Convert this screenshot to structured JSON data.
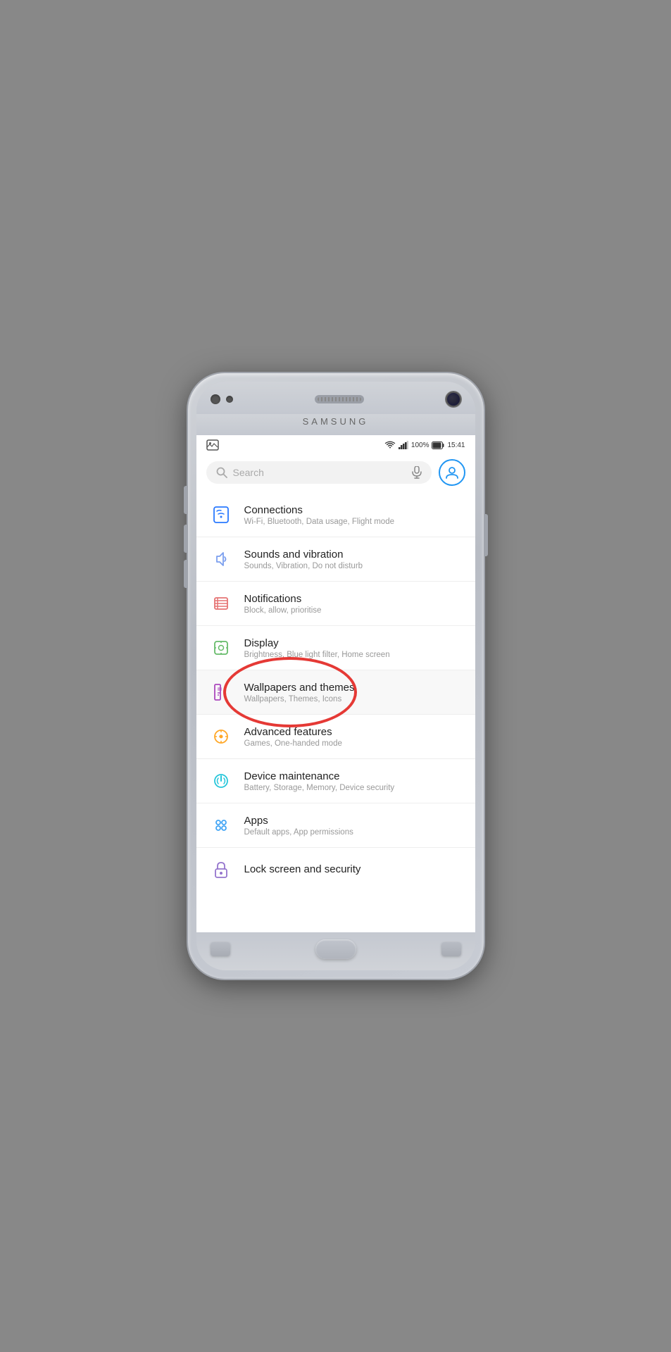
{
  "phone": {
    "brand": "SAMSUNG",
    "status_bar": {
      "time": "15:41",
      "battery": "100%",
      "wifi": true,
      "signal": true
    },
    "search": {
      "placeholder": "Search"
    },
    "settings_items": [
      {
        "id": "connections",
        "title": "Connections",
        "subtitle": "Wi-Fi, Bluetooth, Data usage, Flight mode",
        "icon": "connections"
      },
      {
        "id": "sounds",
        "title": "Sounds and vibration",
        "subtitle": "Sounds, Vibration, Do not disturb",
        "icon": "sounds"
      },
      {
        "id": "notifications",
        "title": "Notifications",
        "subtitle": "Block, allow, prioritise",
        "icon": "notifications"
      },
      {
        "id": "display",
        "title": "Display",
        "subtitle": "Brightness, Blue light filter, Home screen",
        "icon": "display"
      },
      {
        "id": "wallpapers",
        "title": "Wallpapers and themes",
        "subtitle": "Wallpapers, Themes, Icons",
        "icon": "wallpapers",
        "highlighted": true
      },
      {
        "id": "advanced",
        "title": "Advanced features",
        "subtitle": "Games, One-handed mode",
        "icon": "advanced"
      },
      {
        "id": "device",
        "title": "Device maintenance",
        "subtitle": "Battery, Storage, Memory, Device security",
        "icon": "device"
      },
      {
        "id": "apps",
        "title": "Apps",
        "subtitle": "Default apps, App permissions",
        "icon": "apps"
      },
      {
        "id": "lock",
        "title": "Lock screen and security",
        "subtitle": "",
        "icon": "lock"
      }
    ]
  }
}
